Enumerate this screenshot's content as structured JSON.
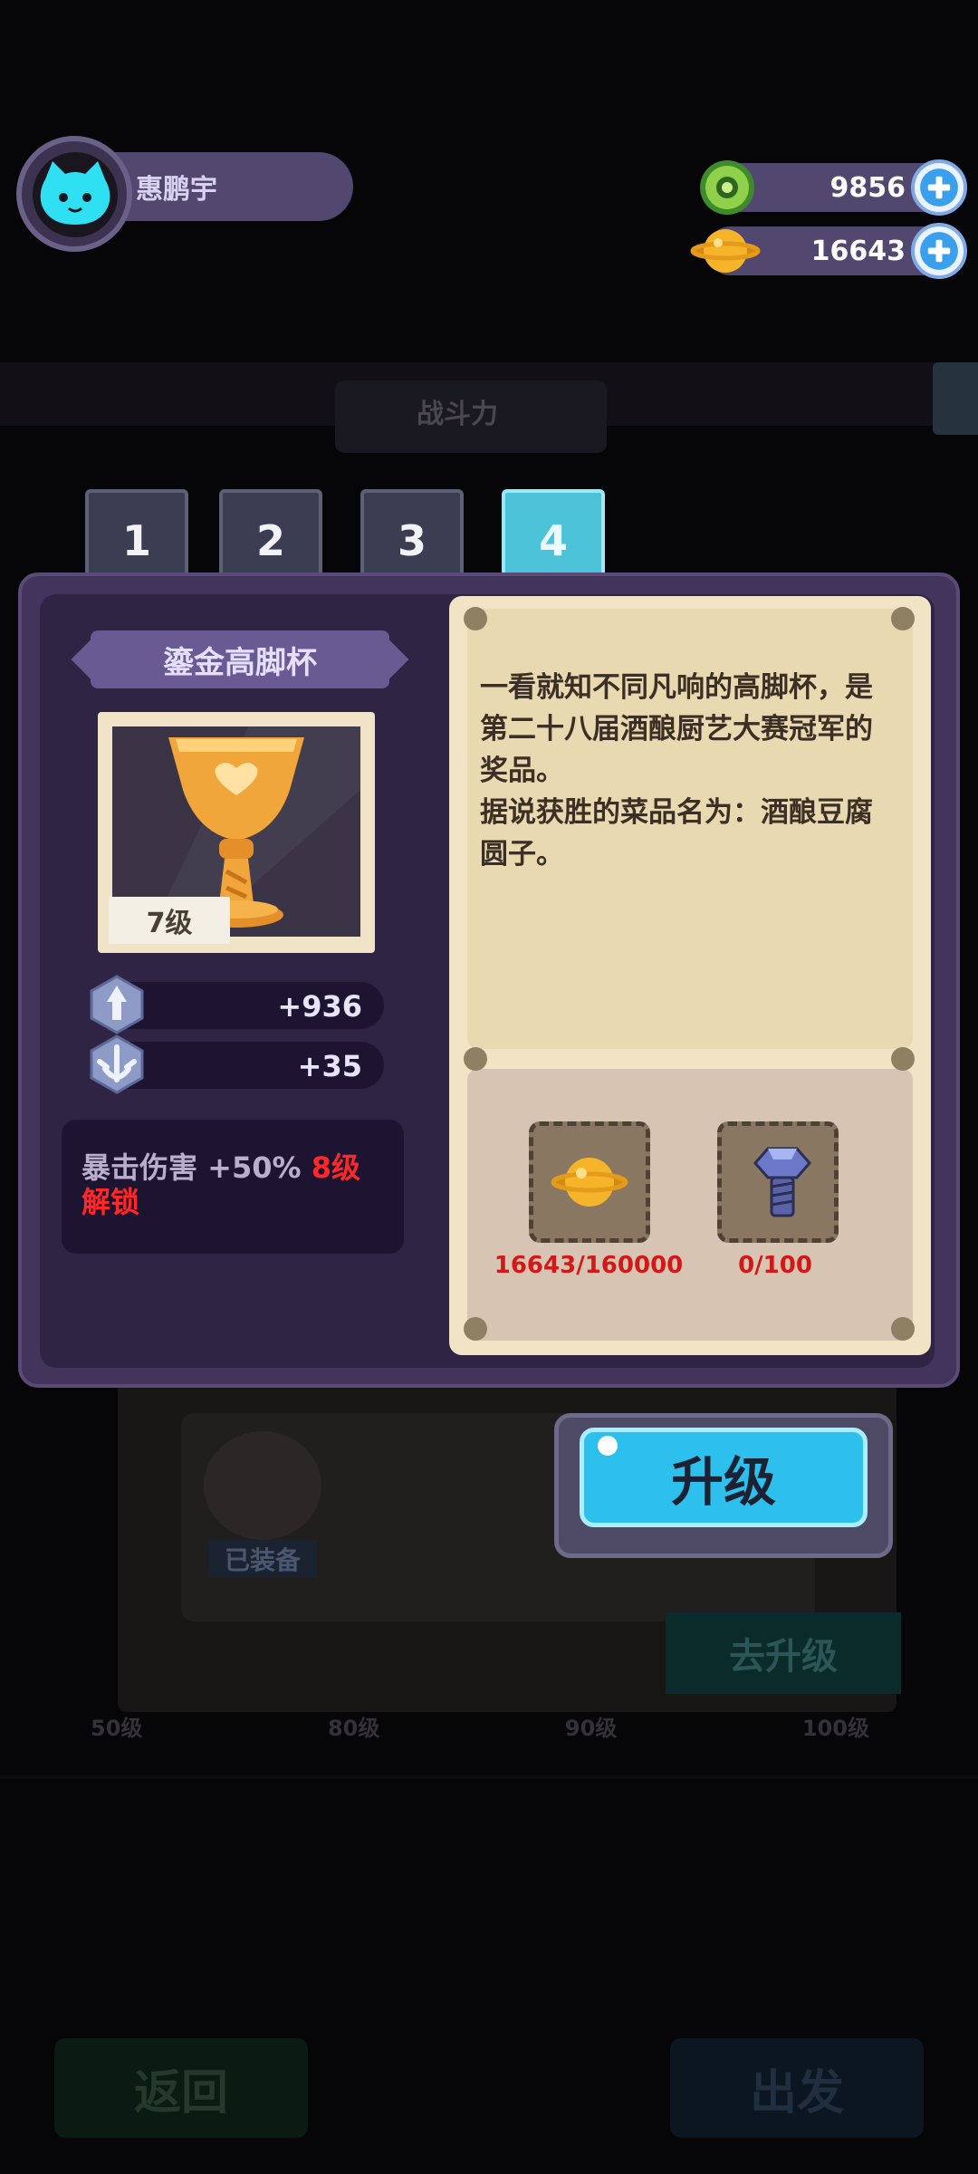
{
  "player": {
    "name": "惠鹏宇",
    "avatar_icon": "cat-avatar-icon"
  },
  "currencies": [
    {
      "name": "gem",
      "icon": "green-gem-icon",
      "value": "9856"
    },
    {
      "name": "coin",
      "icon": "gold-coin-icon",
      "value": "16643"
    }
  ],
  "tabs": [
    {
      "label": "1",
      "active": false
    },
    {
      "label": "2",
      "active": false
    },
    {
      "label": "3",
      "active": false
    },
    {
      "label": "4",
      "active": true
    }
  ],
  "item": {
    "name": "鎏金高脚杯",
    "level": "7级",
    "image_icon": "golden-goblet-icon",
    "stats": [
      {
        "icon": "attack-stat-icon",
        "value": "+936"
      },
      {
        "icon": "defense-stat-icon",
        "value": "+35"
      }
    ],
    "unlock": {
      "text": "暴击伤害 +50% ",
      "highlight": "8级解锁"
    },
    "description": "一看就知不同凡响的高脚杯，是第二十八届酒酿厨艺大赛冠军的奖品。\n据说获胜的菜品名为：酒酿豆腐圆子。"
  },
  "costs": [
    {
      "icon": "gold-coin-icon",
      "label": "16643/160000"
    },
    {
      "icon": "bolt-icon",
      "label": "0/100"
    }
  ],
  "upgrade_button": {
    "label": "升级"
  },
  "background": {
    "power_label": "战斗力",
    "equipped_label": "已装备",
    "go_upgrade_label": "去升级",
    "level_marks": [
      "50级",
      "80级",
      "90级",
      "100级"
    ],
    "back_label": "返回",
    "depart_label": "出发"
  },
  "colors": {
    "panel": "#43345c",
    "paper": "#f0e4c5",
    "accent_cyan": "#2ec0ec",
    "unlock_red": "#ff2828",
    "cost_red": "#d31818"
  }
}
